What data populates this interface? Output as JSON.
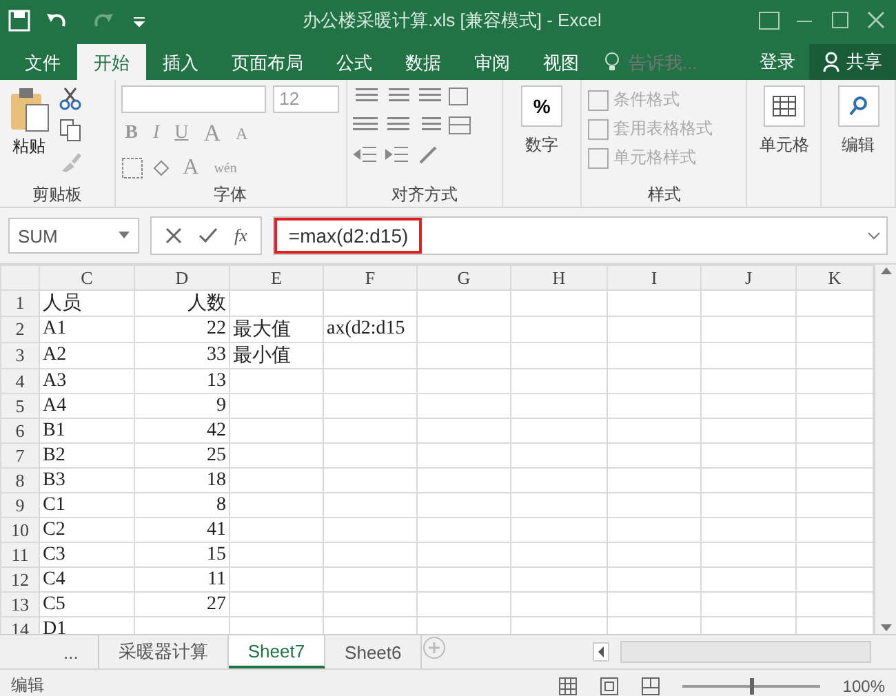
{
  "title_bar": {
    "title": "办公楼采暖计算.xls  [兼容模式] - Excel"
  },
  "tabs": [
    {
      "label": "文件",
      "selected": false
    },
    {
      "label": "开始",
      "selected": true
    },
    {
      "label": "插入",
      "selected": false
    },
    {
      "label": "页面布局",
      "selected": false
    },
    {
      "label": "公式",
      "selected": false
    },
    {
      "label": "数据",
      "selected": false
    },
    {
      "label": "审阅",
      "selected": false
    },
    {
      "label": "视图",
      "selected": false
    }
  ],
  "tell_me": {
    "placeholder": "告诉我..."
  },
  "sign_in": "登录",
  "share": "共享",
  "ribbon": {
    "groups": [
      {
        "kind": "clipboard",
        "label": "剪贴板",
        "paste": "粘贴"
      },
      {
        "kind": "font",
        "label": "字体",
        "size": "12",
        "bold": "B",
        "italic": "I",
        "underline": "U",
        "grow": "A",
        "shrink": "A",
        "font_color": "A",
        "phonetic": "wén"
      },
      {
        "kind": "alignment",
        "label": "对齐方式"
      },
      {
        "kind": "number",
        "label": "数字",
        "symbol": "%"
      },
      {
        "kind": "styles",
        "label": "样式",
        "items": [
          {
            "label": "条件格式",
            "disabled": true
          },
          {
            "label": "套用表格格式",
            "disabled": true
          },
          {
            "label": "单元格样式",
            "disabled": true
          }
        ]
      },
      {
        "kind": "cells",
        "label": "单元格"
      },
      {
        "kind": "editing",
        "label": "编辑"
      }
    ]
  },
  "formula_bar": {
    "name_box": "SUM",
    "fx": "fx",
    "formula": "=max(d2:d15)",
    "highlighted": true
  },
  "sheet": {
    "columns": [
      "C",
      "D",
      "E",
      "F",
      "G",
      "H",
      "I",
      "J",
      "K"
    ],
    "rows": [
      {
        "number": "1",
        "cells": [
          "人员",
          "人数"
        ]
      },
      {
        "number": "2",
        "cells": [
          "A1",
          "22",
          "最大值",
          "ax(d2:d15"
        ]
      },
      {
        "number": "3",
        "cells": [
          "A2",
          "33",
          "最小值"
        ]
      },
      {
        "number": "4",
        "cells": [
          "A3",
          "13"
        ]
      },
      {
        "number": "5",
        "cells": [
          "A4",
          "9"
        ]
      },
      {
        "number": "6",
        "cells": [
          "B1",
          "42"
        ]
      },
      {
        "number": "7",
        "cells": [
          "B2",
          "25"
        ]
      },
      {
        "number": "8",
        "cells": [
          "B3",
          "18"
        ]
      },
      {
        "number": "9",
        "cells": [
          "C1",
          "8"
        ]
      },
      {
        "number": "10",
        "cells": [
          "C2",
          "41"
        ]
      },
      {
        "number": "11",
        "cells": [
          "C3",
          "15"
        ]
      },
      {
        "number": "12",
        "cells": [
          "C4",
          "11"
        ]
      },
      {
        "number": "13",
        "cells": [
          "C5",
          "27"
        ]
      },
      {
        "number": "14",
        "cells": [
          "D1"
        ]
      }
    ]
  },
  "sheet_tabs": [
    {
      "label": "...",
      "selected": false
    },
    {
      "label": "采暖器计算",
      "selected": false
    },
    {
      "label": "Sheet7",
      "selected": true
    },
    {
      "label": "Sheet6",
      "selected": false
    }
  ],
  "status_bar": {
    "mode": "编辑",
    "zoom": {
      "level": 0.5,
      "reading": "100%"
    }
  }
}
